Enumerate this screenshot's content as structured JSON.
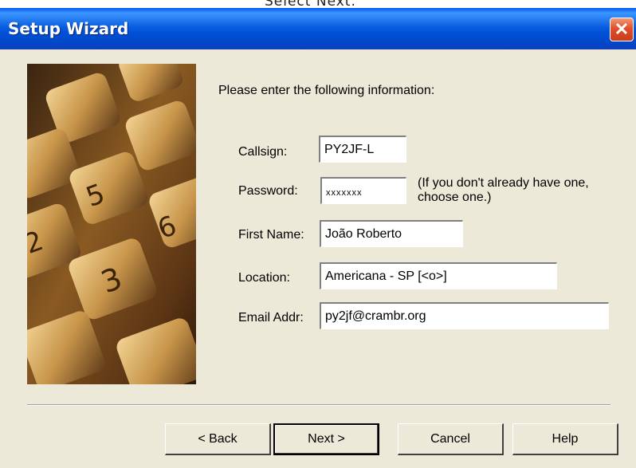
{
  "caption": {
    "text": "Select Next."
  },
  "window": {
    "title": "Setup Wizard",
    "close_glyph": "✕"
  },
  "form": {
    "intro": "Please enter the following information:",
    "callsign": {
      "label": "Callsign:",
      "value": "PY2JF-L"
    },
    "password": {
      "label": "Password:",
      "value": "xxxxxxx",
      "note": "(If you don't already have one, choose one.)"
    },
    "first_name": {
      "label": "First Name:",
      "value": "João Roberto"
    },
    "location": {
      "label": "Location:",
      "value": "Americana - SP [<o>]"
    },
    "email": {
      "label": "Email Addr:",
      "value": "py2jf@crambr.org"
    }
  },
  "buttons": {
    "back": "< Back",
    "next": "Next >",
    "cancel": "Cancel",
    "help": "Help"
  },
  "icons": {
    "close": "close-icon",
    "art": "keypad-image"
  },
  "colors": {
    "titlebar": "#0a5fe0",
    "dialog_bg": "#ece9d8",
    "close": "#e0502b"
  }
}
